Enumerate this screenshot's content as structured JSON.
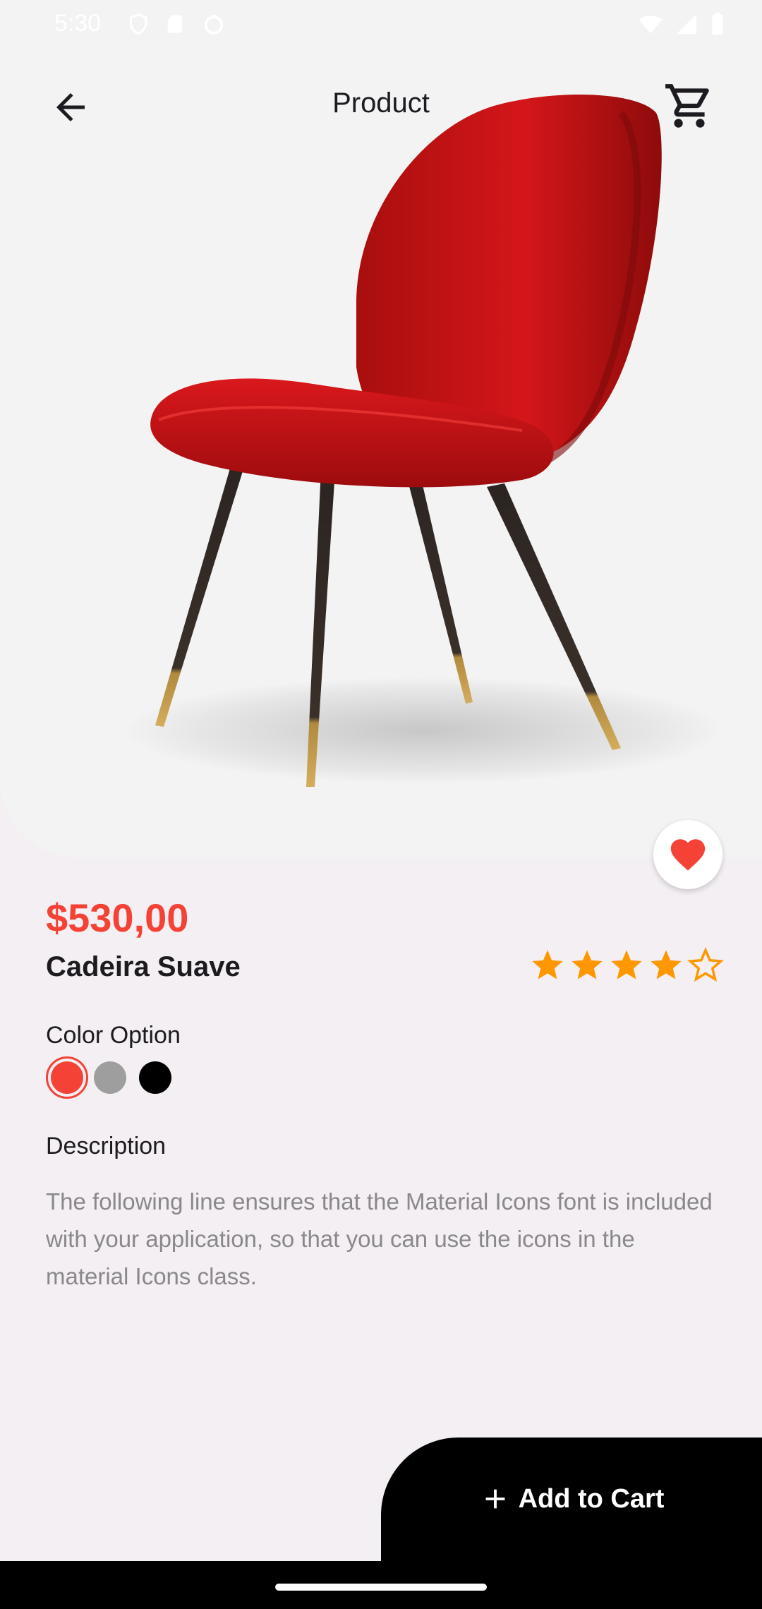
{
  "status_bar": {
    "time": "5:30",
    "left_icons": [
      "shield-icon",
      "sd-card-icon",
      "circle-icon"
    ],
    "right_icons": [
      "wifi-icon",
      "signal-icon",
      "battery-icon"
    ]
  },
  "app_bar": {
    "title": "Product",
    "back_icon": "arrow-back-icon",
    "cart_icon": "shopping-cart-icon"
  },
  "product": {
    "price": "$530,00",
    "name": "Cadeira Suave",
    "rating": 4,
    "rating_max": 5,
    "favorite": true
  },
  "colors": {
    "label": "Color Option",
    "options": [
      {
        "hex": "#f44336",
        "selected": true
      },
      {
        "hex": "#9e9e9e",
        "selected": false
      },
      {
        "hex": "#000000",
        "selected": false
      }
    ]
  },
  "description": {
    "label": "Description",
    "text": "The following line ensures that the Material Icons font is included with your application, so that you can use the icons in the material Icons class."
  },
  "cta": {
    "label": "Add to Cart",
    "icon": "plus-icon"
  },
  "theme": {
    "accent": "#f44336",
    "star": "#ff9800",
    "background": "#f3eff3"
  }
}
